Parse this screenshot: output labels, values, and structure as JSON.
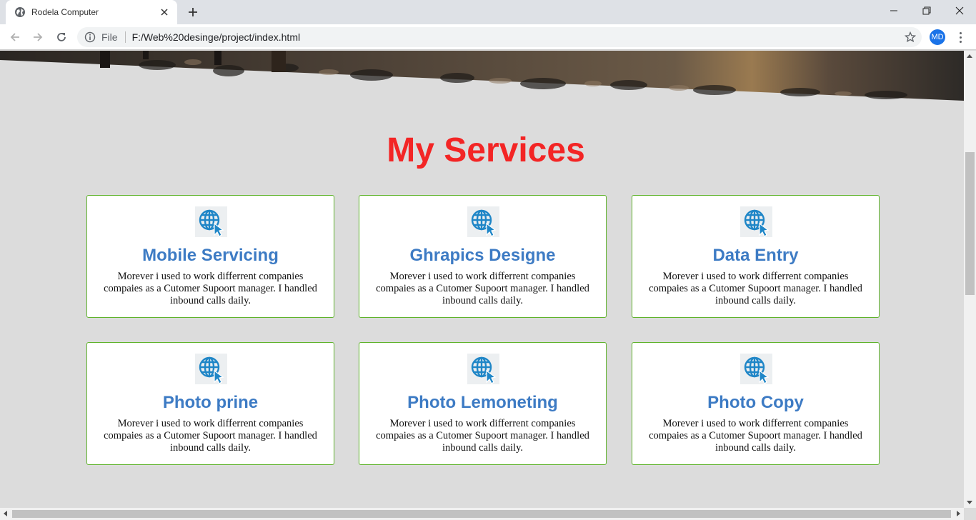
{
  "browser": {
    "tab_title": "Rodela Computer",
    "omnibox_scheme": "File",
    "omnibox_url": "F:/Web%20desinge/project/index.html",
    "profile_initials": "MD"
  },
  "page": {
    "section_title": "My Services",
    "services": [
      {
        "title": "Mobile Servicing",
        "description": "Morever i used to work differrent companies compaies as a Cutomer Supoort manager. I handled inbound calls daily."
      },
      {
        "title": "Ghrapics Designe",
        "description": "Morever i used to work differrent companies compaies as a Cutomer Supoort manager. I handled inbound calls daily."
      },
      {
        "title": "Data Entry",
        "description": "Morever i used to work differrent companies compaies as a Cutomer Supoort manager. I handled inbound calls daily."
      },
      {
        "title": "Photo prine",
        "description": "Morever i used to work differrent companies compaies as a Cutomer Supoort manager. I handled inbound calls daily."
      },
      {
        "title": "Photo Lemoneting",
        "description": "Morever i used to work differrent companies compaies as a Cutomer Supoort manager. I handled inbound calls daily."
      },
      {
        "title": "Photo Copy",
        "description": "Morever i used to work differrent companies compaies as a Cutomer Supoort manager. I handled inbound calls daily."
      }
    ],
    "service_icon": "globe-cursor-icon"
  },
  "colors": {
    "title_red": "#f32525",
    "card_title_blue": "#3d7bc4",
    "card_border_green": "#5fb32b",
    "page_bg": "#dcdcdc",
    "icon_blue": "#1f86c7"
  }
}
